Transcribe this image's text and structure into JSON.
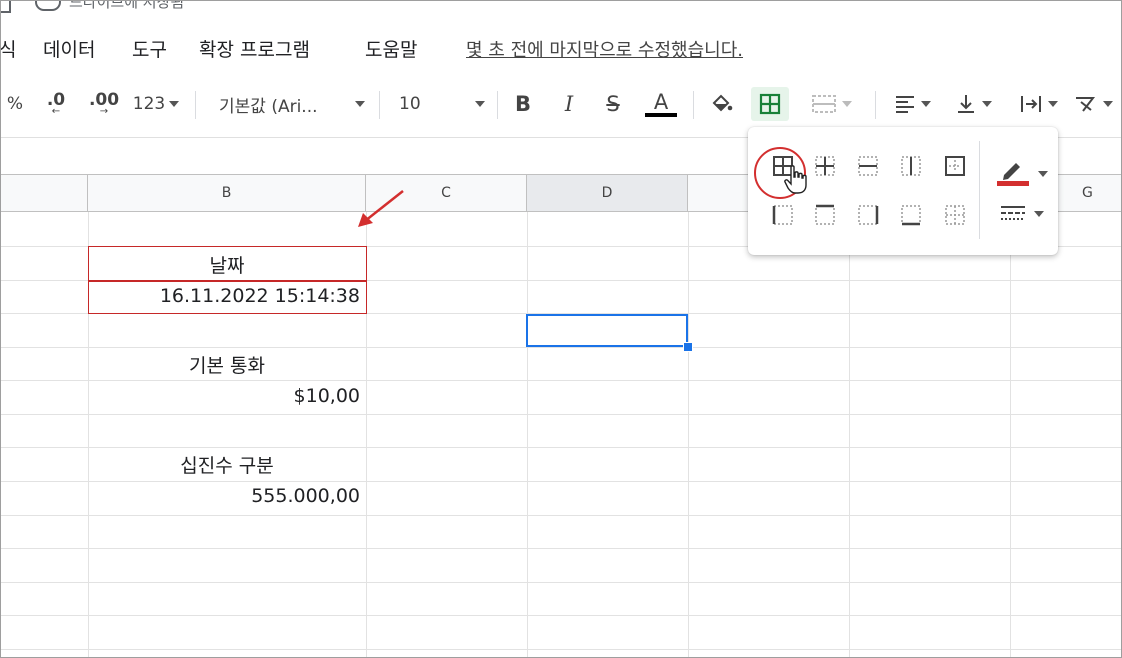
{
  "top": {
    "saved_text": "드라이브에 저장됨"
  },
  "menu": {
    "items": [
      "식",
      "데이터",
      "도구",
      "확장 프로그램",
      "도움말"
    ],
    "last_edit": "몇 초 전에 마지막으로 수정했습니다."
  },
  "toolbar": {
    "percent": "%",
    "dec_decrease": ".0",
    "dec_increase": ".00",
    "format_more": "123",
    "font": "기본값 (Ari...",
    "font_size": "10",
    "bold": "B",
    "italic": "I",
    "strike": "S",
    "text_color": "A",
    "colors": {
      "text_color_bar": "#000000",
      "borders_active": "#188038",
      "pen_color_bar": "#d32f2f"
    }
  },
  "columns": [
    "B",
    "C",
    "D",
    "",
    "G"
  ],
  "cells": {
    "date_header": "날짜",
    "date_value": "16.11.2022 15:14:38",
    "currency_header": "기본 통화",
    "currency_value": "$10,00",
    "decimal_header": "십진수 구분",
    "decimal_value": "555.000,00"
  },
  "borders_menu": {
    "row1": [
      "all-borders-icon",
      "inner-borders-icon",
      "horizontal-borders-icon",
      "vertical-borders-icon",
      "outer-borders-icon"
    ],
    "row2": [
      "left-border-icon",
      "top-border-icon",
      "right-border-icon",
      "bottom-border-icon",
      "clear-borders-icon"
    ],
    "highlighted": "all-borders-icon",
    "side": [
      "border-color-icon",
      "border-style-icon"
    ]
  }
}
